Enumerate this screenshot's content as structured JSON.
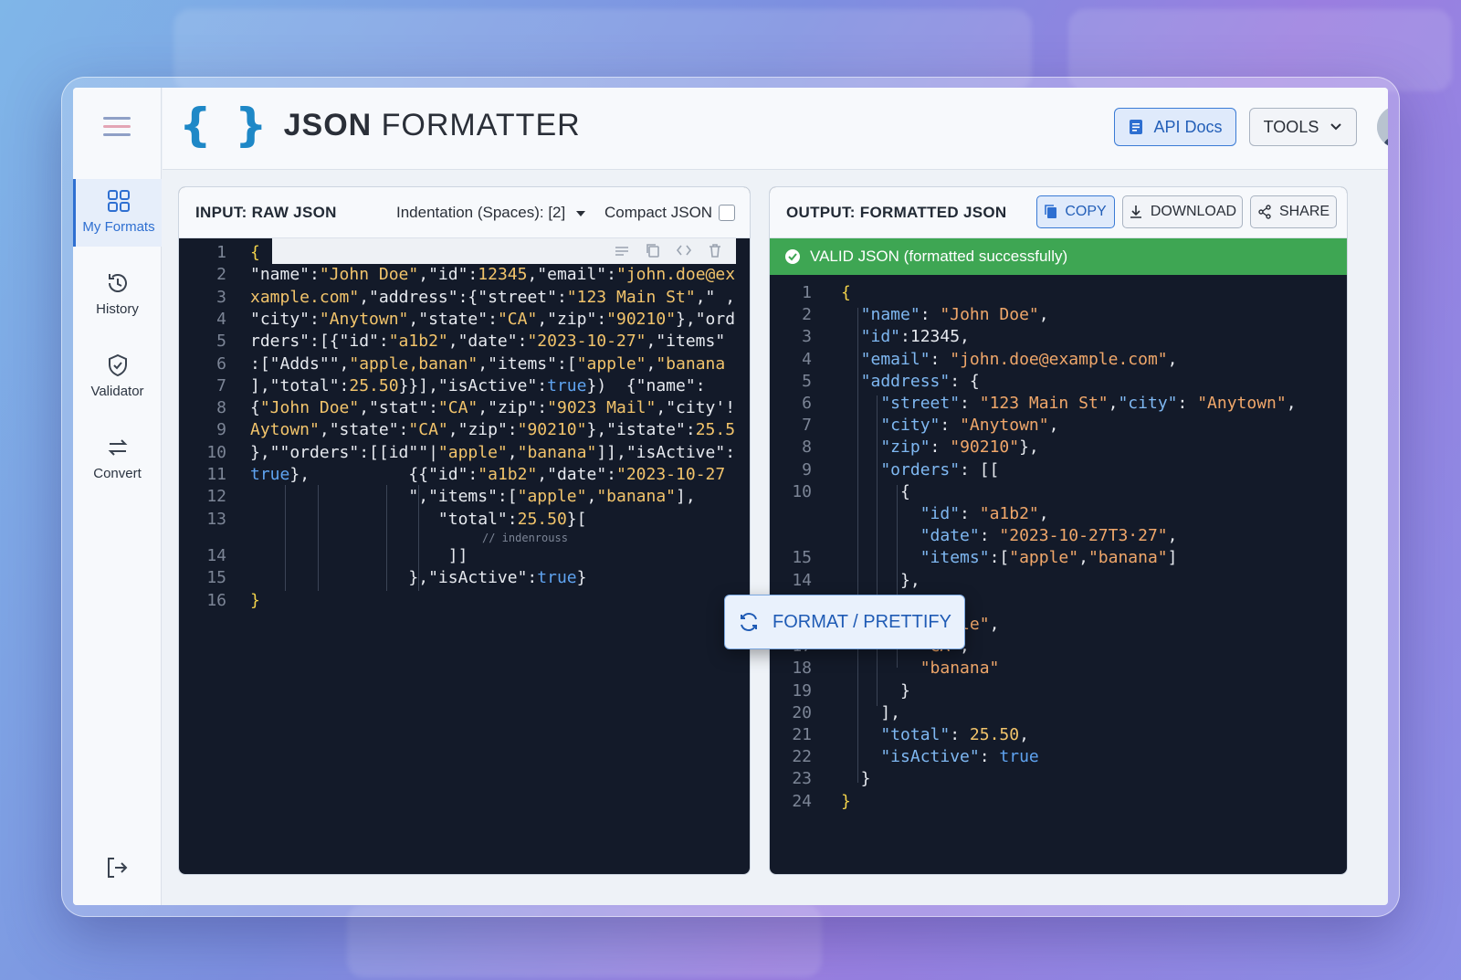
{
  "app": {
    "brand_bold": "JSON",
    "brand_rest": "FORMATTER",
    "brace": "{ }"
  },
  "header": {
    "api_docs": "API Docs",
    "tools": "TOOLS"
  },
  "sidebar": {
    "items": [
      {
        "label": "My Formats",
        "icon": "grid-icon"
      },
      {
        "label": "History",
        "icon": "history-icon"
      },
      {
        "label": "Validator",
        "icon": "shield-check-icon"
      },
      {
        "label": "Convert",
        "icon": "convert-arrows-icon"
      }
    ]
  },
  "input_panel": {
    "title": "INPUT: RAW JSON",
    "indentation": "Indentation (Spaces): [2]",
    "compact": "Compact JSON",
    "lines": [
      [
        {
          "t": "{",
          "c": "y"
        }
      ],
      [
        {
          "t": "\"name\":",
          "c": "k"
        },
        {
          "t": "\"John Doe\"",
          "c": "s"
        },
        {
          "t": ",\"id\":",
          "c": "k"
        },
        {
          "t": "12345",
          "c": "n"
        },
        {
          "t": ",\"email\":",
          "c": "k"
        },
        {
          "t": "\"john.doe@ex",
          "c": "s"
        }
      ],
      [
        {
          "t": "xample.com\"",
          "c": "s"
        },
        {
          "t": ",\"address\":{\"street\":",
          "c": "k"
        },
        {
          "t": "\"123 Main St\"",
          "c": "s"
        },
        {
          "t": ",\" ,",
          "c": "k"
        }
      ],
      [
        {
          "t": "\"city\":",
          "c": "k"
        },
        {
          "t": "\"Anytown\"",
          "c": "s"
        },
        {
          "t": ",\"state\":",
          "c": "k"
        },
        {
          "t": "\"CA\"",
          "c": "s"
        },
        {
          "t": ",\"zip\":",
          "c": "k"
        },
        {
          "t": "\"90210\"",
          "c": "s"
        },
        {
          "t": "},\"ord",
          "c": "k"
        }
      ],
      [
        {
          "t": "rders\":[{\"id\":",
          "c": "k"
        },
        {
          "t": "\"a1b2\"",
          "c": "s"
        },
        {
          "t": ",\"date\":",
          "c": "k"
        },
        {
          "t": "\"2023-10-27\"",
          "c": "s"
        },
        {
          "t": ",\"items\"",
          "c": "k"
        }
      ],
      [
        {
          "t": ":[\"Adds\"\",",
          "c": "k"
        },
        {
          "t": "\"apple,banan\"",
          "c": "s"
        },
        {
          "t": ",\"items\":[",
          "c": "k"
        },
        {
          "t": "\"apple\"",
          "c": "s"
        },
        {
          "t": ",",
          "c": "k"
        },
        {
          "t": "\"banana",
          "c": "s"
        }
      ],
      [
        {
          "t": "],\"total\":",
          "c": "k"
        },
        {
          "t": "25.50",
          "c": "n"
        },
        {
          "t": "}}],\"isActive\":",
          "c": "k"
        },
        {
          "t": "true",
          "c": "b"
        },
        {
          "t": "})  {\"name\":",
          "c": "k"
        }
      ],
      [
        {
          "t": "{",
          "c": "k"
        },
        {
          "t": "\"John Doe\"",
          "c": "s"
        },
        {
          "t": ",\"stat\":",
          "c": "k"
        },
        {
          "t": "\"CA\"",
          "c": "s"
        },
        {
          "t": ",\"zip\":",
          "c": "k"
        },
        {
          "t": "\"9023 Mail\"",
          "c": "s"
        },
        {
          "t": ",\"city'!",
          "c": "k"
        }
      ],
      [
        {
          "t": "Aytown\"",
          "c": "s"
        },
        {
          "t": ",\"state\":",
          "c": "k"
        },
        {
          "t": "\"CA\"",
          "c": "s"
        },
        {
          "t": ",\"zip\":",
          "c": "k"
        },
        {
          "t": "\"90210\"",
          "c": "s"
        },
        {
          "t": "},\"istate\":",
          "c": "k"
        },
        {
          "t": "25.5",
          "c": "n"
        }
      ],
      [
        {
          "t": "},\"\"orders\":[[id\"\"|",
          "c": "k"
        },
        {
          "t": "\"apple\"",
          "c": "s"
        },
        {
          "t": ",",
          "c": "k"
        },
        {
          "t": "\"banana\"",
          "c": "s"
        },
        {
          "t": "]],\"isActive\":",
          "c": "k"
        }
      ],
      [
        {
          "t": "true",
          "c": "b"
        },
        {
          "t": "},          {{\"id\":",
          "c": "k"
        },
        {
          "t": "\"a1b2\"",
          "c": "s"
        },
        {
          "t": ",\"date\":",
          "c": "k"
        },
        {
          "t": "\"2023-10-27",
          "c": "s"
        }
      ],
      [
        {
          "t": "                \",\"items\":[",
          "c": "k"
        },
        {
          "t": "\"apple\"",
          "c": "s"
        },
        {
          "t": ",",
          "c": "k"
        },
        {
          "t": "\"banana\"",
          "c": "s"
        },
        {
          "t": "],",
          "c": "k"
        }
      ],
      [
        {
          "t": "                   \"total\":",
          "c": "k"
        },
        {
          "t": "25.50",
          "c": "n"
        },
        {
          "t": "}[",
          "c": "k"
        }
      ],
      [
        {
          "t": "                    ]]",
          "c": "k"
        }
      ],
      [
        {
          "t": "                },\"isActive\":",
          "c": "k"
        },
        {
          "t": "true",
          "c": "b"
        },
        {
          "t": "}",
          "c": "k"
        }
      ],
      [
        {
          "t": "}",
          "c": "y"
        }
      ]
    ],
    "comment": "// indenrouss"
  },
  "output_panel": {
    "title": "OUTPUT: FORMATTED JSON",
    "copy": "COPY",
    "download": "DOWNLOAD",
    "share": "SHARE",
    "valid": "VALID JSON (formatted successfully)",
    "lines": [
      {
        "n": "1",
        "parts": [
          {
            "t": "{",
            "c": "y"
          }
        ]
      },
      {
        "n": "2",
        "parts": [
          {
            "t": "  \"name\"",
            "c": "sk"
          },
          {
            "t": ": ",
            "c": "p"
          },
          {
            "t": "\"John Doe\"",
            "c": "so"
          },
          {
            "t": ",",
            "c": "p"
          }
        ]
      },
      {
        "n": "3",
        "parts": [
          {
            "t": "  \"id\"",
            "c": "sk"
          },
          {
            "t": ":12345,",
            "c": "p"
          }
        ]
      },
      {
        "n": "4",
        "parts": [
          {
            "t": "  \"email\"",
            "c": "sk"
          },
          {
            "t": ": ",
            "c": "p"
          },
          {
            "t": "\"john.doe@example.com\"",
            "c": "so"
          },
          {
            "t": ",",
            "c": "p"
          }
        ]
      },
      {
        "n": "5",
        "parts": [
          {
            "t": "  \"address\"",
            "c": "sk"
          },
          {
            "t": ": {",
            "c": "p"
          }
        ]
      },
      {
        "n": "6",
        "parts": [
          {
            "t": "    \"street\"",
            "c": "sk"
          },
          {
            "t": ": ",
            "c": "p"
          },
          {
            "t": "\"123 Main St\"",
            "c": "so"
          },
          {
            "t": ",",
            "c": "p"
          },
          {
            "t": "\"city\"",
            "c": "sk"
          },
          {
            "t": ": ",
            "c": "p"
          },
          {
            "t": "\"Anytown\"",
            "c": "so"
          },
          {
            "t": ",",
            "c": "p"
          }
        ]
      },
      {
        "n": "7",
        "parts": [
          {
            "t": "    \"city\"",
            "c": "sk"
          },
          {
            "t": ": ",
            "c": "p"
          },
          {
            "t": "\"Anytown\"",
            "c": "so"
          },
          {
            "t": ",",
            "c": "p"
          }
        ]
      },
      {
        "n": "8",
        "parts": [
          {
            "t": "    \"zip\"",
            "c": "sk"
          },
          {
            "t": ": ",
            "c": "p"
          },
          {
            "t": "\"90210\"",
            "c": "so"
          },
          {
            "t": "},",
            "c": "p"
          }
        ]
      },
      {
        "n": "9",
        "parts": [
          {
            "t": "    \"orders\"",
            "c": "sk"
          },
          {
            "t": ": [[",
            "c": "p"
          }
        ]
      },
      {
        "n": "10",
        "parts": [
          {
            "t": "      {",
            "c": "p"
          }
        ]
      },
      {
        "n": "",
        "parts": [
          {
            "t": "        \"id\"",
            "c": "sk"
          },
          {
            "t": ": ",
            "c": "p"
          },
          {
            "t": "\"a1b2\"",
            "c": "so"
          },
          {
            "t": ",",
            "c": "p"
          }
        ]
      },
      {
        "n": "",
        "parts": [
          {
            "t": "        \"date\"",
            "c": "sk"
          },
          {
            "t": ": ",
            "c": "p"
          },
          {
            "t": "\"2023-10-27T3·27\"",
            "c": "so"
          },
          {
            "t": ",",
            "c": "p"
          }
        ]
      },
      {
        "n": "15",
        "parts": [
          {
            "t": "        \"items\"",
            "c": "sk"
          },
          {
            "t": ":[",
            "c": "p"
          },
          {
            "t": "\"apple\"",
            "c": "so"
          },
          {
            "t": ",",
            "c": "p"
          },
          {
            "t": "\"banana\"",
            "c": "so"
          },
          {
            "t": "]",
            "c": "p"
          }
        ]
      },
      {
        "n": "14",
        "parts": [
          {
            "t": "      },",
            "c": "p"
          }
        ]
      },
      {
        "n": "15",
        "parts": [
          {
            "t": "      {",
            "c": "p"
          }
        ]
      },
      {
        "n": "16",
        "parts": [
          {
            "t": "        \"apple\"",
            "c": "so"
          },
          {
            "t": ",",
            "c": "p"
          }
        ]
      },
      {
        "n": "17",
        "parts": [
          {
            "t": "        \"CA\"",
            "c": "so"
          },
          {
            "t": ",",
            "c": "p"
          }
        ]
      },
      {
        "n": "18",
        "parts": [
          {
            "t": "        \"banana\"",
            "c": "so"
          }
        ]
      },
      {
        "n": "19",
        "parts": [
          {
            "t": "      }",
            "c": "p"
          }
        ]
      },
      {
        "n": "20",
        "parts": [
          {
            "t": "    ],",
            "c": "p"
          }
        ]
      },
      {
        "n": "21",
        "parts": [
          {
            "t": "    \"total\"",
            "c": "sk"
          },
          {
            "t": ": ",
            "c": "p"
          },
          {
            "t": "25.50",
            "c": "n"
          },
          {
            "t": ",",
            "c": "p"
          }
        ]
      },
      {
        "n": "22",
        "parts": [
          {
            "t": "    \"isActive\"",
            "c": "sk"
          },
          {
            "t": ": ",
            "c": "p"
          },
          {
            "t": "true",
            "c": "b"
          }
        ]
      },
      {
        "n": "23",
        "parts": [
          {
            "t": "  }",
            "c": "p"
          }
        ]
      },
      {
        "n": "24",
        "parts": [
          {
            "t": "}",
            "c": "y"
          }
        ]
      }
    ]
  },
  "format_button": "FORMAT / PRETTIFY",
  "colors": {
    "accent": "#2e6fd1",
    "valid": "#3ea653",
    "editor_bg": "#131a29"
  }
}
